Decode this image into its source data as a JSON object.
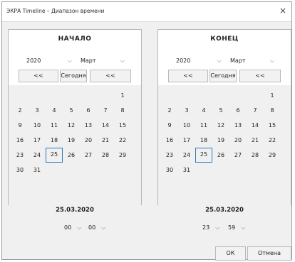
{
  "window": {
    "title": "ЭКРА Timeline – Диапазон времени",
    "close_label": "×"
  },
  "start": {
    "title": "НАЧАЛО",
    "year": "2020",
    "month": "Март",
    "prev_label": "<<",
    "today_label": "Сегодня",
    "next_label": "<<",
    "selected_day": "25",
    "date_label": "25.03.2020",
    "hour": "00",
    "minute": "00"
  },
  "end": {
    "title": "КОНЕЦ",
    "year": "2020",
    "month": "Март",
    "prev_label": "<<",
    "today_label": "Сегодня",
    "next_label": "<<",
    "selected_day": "25",
    "date_label": "25.03.2020",
    "hour": "23",
    "minute": "59"
  },
  "calendar_weeks": [
    [
      "",
      "",
      "",
      "",
      "",
      "",
      "1"
    ],
    [
      "2",
      "3",
      "4",
      "5",
      "6",
      "7",
      "8"
    ],
    [
      "9",
      "10",
      "11",
      "12",
      "13",
      "14",
      "15"
    ],
    [
      "16",
      "17",
      "18",
      "19",
      "20",
      "21",
      "22"
    ],
    [
      "23",
      "24",
      "25",
      "26",
      "27",
      "28",
      "29"
    ],
    [
      "30",
      "31",
      "",
      "",
      "",
      "",
      ""
    ]
  ],
  "dropdown_icon": "chevron-down-icon",
  "buttons": {
    "ok_label": "ОК",
    "cancel_label": "Отмена"
  }
}
